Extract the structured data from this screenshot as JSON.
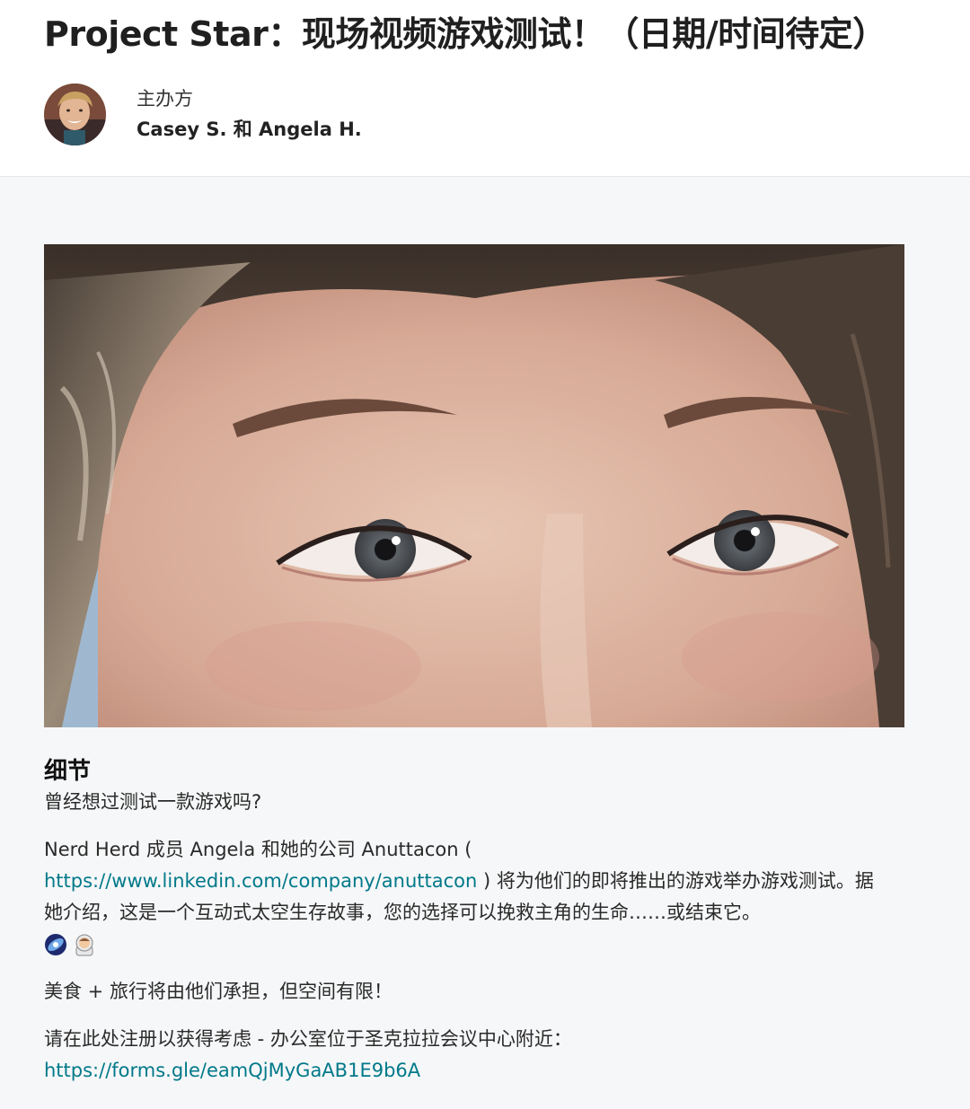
{
  "header": {
    "title": "Project Star：现场视频游戏测试！（日期/时间待定）",
    "host_label": "主办方",
    "host_names": "Casey S. 和 Angela H."
  },
  "details": {
    "heading": "细节",
    "intro": "曾经想过测试一款游戏吗?",
    "para1_before": "Nerd Herd 成员 Angela 和她的公司 Anuttacon (",
    "para1_link": "https://www.linkedin.com/company/anuttacon",
    "para1_after": ") 将为他们的即将推出的游戏举办游戏测试。据她介绍，这是一个互动式太空生存故事，您的选择可以挽救主角的生命……或结束它。",
    "emojis": [
      "galaxy-icon",
      "astronaut-icon"
    ],
    "para2": "美食 + 旅行将由他们承担，但空间有限！",
    "para3": "请在此处注册以获得考虑 - 办公室位于圣克拉拉会议中心附近：",
    "para3_link": "https://forms.gle/eamQjMyGaAB1E9b6A"
  },
  "colors": {
    "link": "#00798a",
    "background": "#f6f7f8",
    "header_bg": "#ffffff"
  }
}
